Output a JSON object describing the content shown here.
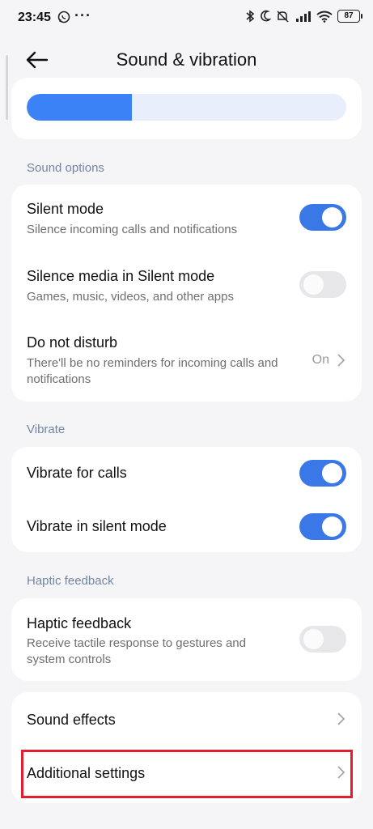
{
  "status_bar": {
    "time": "23:45",
    "dots": "···",
    "battery": "87",
    "icons": [
      "whatsapp-icon",
      "bluetooth-icon",
      "moon-icon",
      "mute-icon",
      "signal-icon",
      "wifi-icon",
      "battery-icon"
    ]
  },
  "header": {
    "title": "Sound & vibration",
    "back_icon": "arrow-left-icon"
  },
  "volume": {
    "level": 0.33,
    "fill_color": "#3b82f6",
    "track_color": "#e8eefc"
  },
  "sections": {
    "sound_options": {
      "label": "Sound options",
      "silent_mode": {
        "title": "Silent mode",
        "subtitle": "Silence incoming calls and notifications",
        "enabled": true
      },
      "silence_media": {
        "title": "Silence media in Silent mode",
        "subtitle": "Games, music, videos, and other apps",
        "enabled": false
      },
      "dnd": {
        "title": "Do not disturb",
        "subtitle": "There'll be no reminders for incoming calls and notifications",
        "value": "On"
      }
    },
    "vibrate": {
      "label": "Vibrate",
      "calls": {
        "title": "Vibrate for calls",
        "enabled": true
      },
      "silent": {
        "title": "Vibrate in silent mode",
        "enabled": true
      }
    },
    "haptic": {
      "label": "Haptic feedback",
      "haptic_feedback": {
        "title": "Haptic feedback",
        "subtitle": "Receive tactile response to gestures and system controls",
        "enabled": false
      }
    },
    "more": {
      "sound_effects": {
        "title": "Sound effects"
      },
      "additional_settings": {
        "title": "Additional settings",
        "highlighted": true
      }
    }
  },
  "colors": {
    "accent": "#3b78e7",
    "highlight": "#e0202e",
    "section_label": "#7285a3",
    "background": "#f5f5f7"
  }
}
